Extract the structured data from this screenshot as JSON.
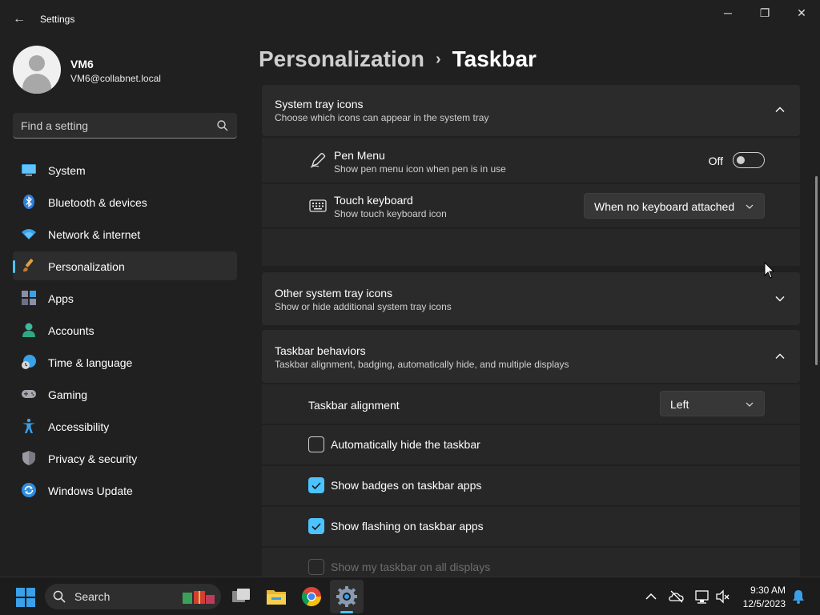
{
  "window": {
    "title": "Settings",
    "back_glyph": "←",
    "minimize_glyph": "─",
    "maximize_glyph": "❐",
    "close_glyph": "✕"
  },
  "user": {
    "name": "VM6",
    "email": "VM6@collabnet.local"
  },
  "search": {
    "placeholder": "Find a setting"
  },
  "nav": {
    "items": [
      {
        "label": "System",
        "icon": "system-icon"
      },
      {
        "label": "Bluetooth & devices",
        "icon": "bluetooth-icon"
      },
      {
        "label": "Network & internet",
        "icon": "wifi-icon"
      },
      {
        "label": "Personalization",
        "icon": "brush-icon",
        "selected": true
      },
      {
        "label": "Apps",
        "icon": "apps-icon"
      },
      {
        "label": "Accounts",
        "icon": "accounts-icon"
      },
      {
        "label": "Time & language",
        "icon": "globe-clock-icon"
      },
      {
        "label": "Gaming",
        "icon": "gamepad-icon"
      },
      {
        "label": "Accessibility",
        "icon": "accessibility-icon"
      },
      {
        "label": "Privacy & security",
        "icon": "shield-icon"
      },
      {
        "label": "Windows Update",
        "icon": "update-icon"
      }
    ]
  },
  "header": {
    "parent": "Personalization",
    "separator": "›",
    "current": "Taskbar"
  },
  "system_tray_icons": {
    "title": "System tray icons",
    "description": "Choose which icons can appear in the system tray",
    "expanded": true,
    "pen_menu": {
      "title": "Pen Menu",
      "description": "Show pen menu icon when pen is in use",
      "state_label": "Off",
      "on": false
    },
    "touch_keyboard": {
      "title": "Touch keyboard",
      "description": "Show touch keyboard icon",
      "value": "When no keyboard attached"
    }
  },
  "other_tray_icons": {
    "title": "Other system tray icons",
    "description": "Show or hide additional system tray icons",
    "expanded": false
  },
  "taskbar_behaviors": {
    "title": "Taskbar behaviors",
    "description": "Taskbar alignment, badging, automatically hide, and multiple displays",
    "expanded": true,
    "alignment": {
      "label": "Taskbar alignment",
      "value": "Left"
    },
    "options": [
      {
        "label": "Automatically hide the taskbar",
        "checked": false,
        "enabled": true
      },
      {
        "label": "Show badges on taskbar apps",
        "checked": true,
        "enabled": true
      },
      {
        "label": "Show flashing on taskbar apps",
        "checked": true,
        "enabled": true
      },
      {
        "label": "Show my taskbar on all displays",
        "checked": false,
        "enabled": false
      }
    ]
  },
  "taskbar": {
    "search_label": "Search",
    "apps": [
      "task-view-icon",
      "file-explorer-icon",
      "chrome-icon",
      "settings-icon"
    ],
    "active_app": "settings-icon",
    "tray": [
      "chevron-up-icon",
      "onedrive-icon",
      "network-icon",
      "volume-muted-icon"
    ],
    "time": "9:30 AM",
    "date": "12/5/2023"
  },
  "colors": {
    "accent": "#4cc2ff",
    "background": "#202020",
    "card": "#2b2b2b"
  }
}
